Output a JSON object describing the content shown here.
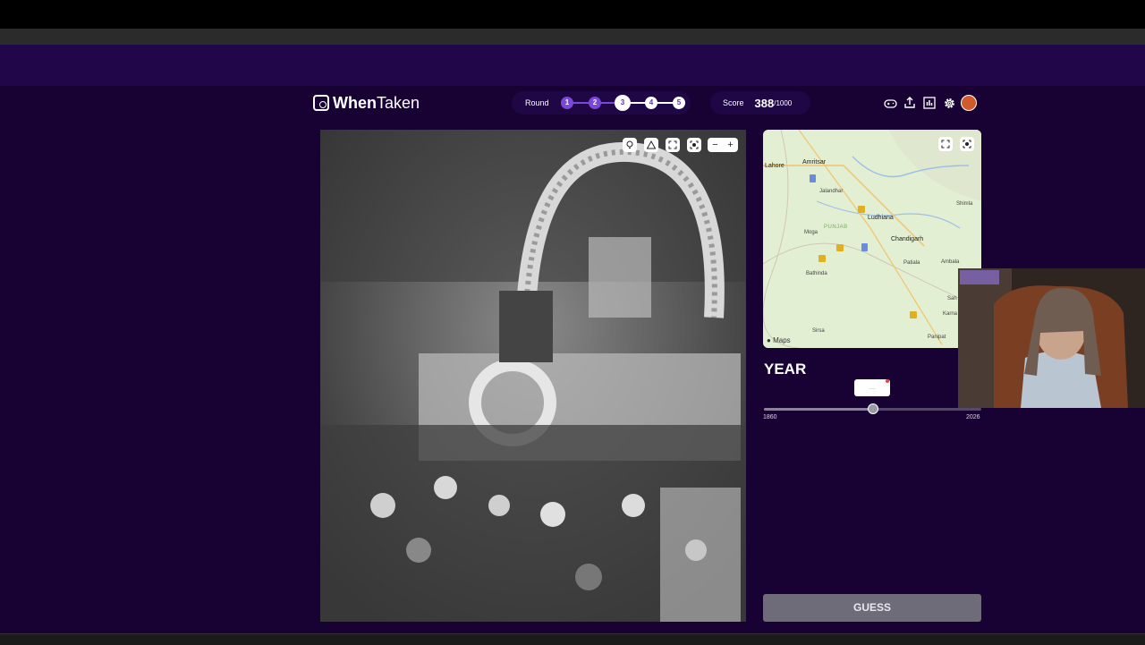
{
  "app": {
    "logo_bold": "When",
    "logo_light": "Taken"
  },
  "round": {
    "label": "Round",
    "current": 3,
    "steps": [
      "1",
      "2",
      "3",
      "4",
      "5"
    ]
  },
  "score": {
    "label": "Score",
    "value": "388",
    "max": "/1000"
  },
  "header_icons": [
    "gamepad-icon",
    "share-icon",
    "leaderboard-icon",
    "gear-icon",
    "avatar"
  ],
  "photo": {
    "tools": [
      "hint-icon",
      "report-icon",
      "fullscreen-icon",
      "recenter-icon"
    ],
    "zoom_out": "−",
    "zoom_in": "+"
  },
  "map": {
    "cities": [
      "Lahore",
      "Amritsar",
      "Jalandhar",
      "Ludhiana",
      "Moga",
      "Chandigarh",
      "Patiala",
      "Ambala",
      "Bathinda",
      "Shimla",
      "Sirsa",
      "Panipat",
      "Karna",
      "Sah"
    ],
    "regions": [
      "PUNJAB"
    ],
    "attribution": "Maps"
  },
  "year": {
    "title": "YEAR",
    "bubble": "....",
    "min": "1860",
    "max": "2026",
    "value_fraction": 0.5
  },
  "guess": {
    "label": "GUESS"
  },
  "colors": {
    "page_bg": "#170233",
    "header_bg": "#21064a",
    "accent": "#7b47d8",
    "guess_bg": "#6f6c7a"
  }
}
